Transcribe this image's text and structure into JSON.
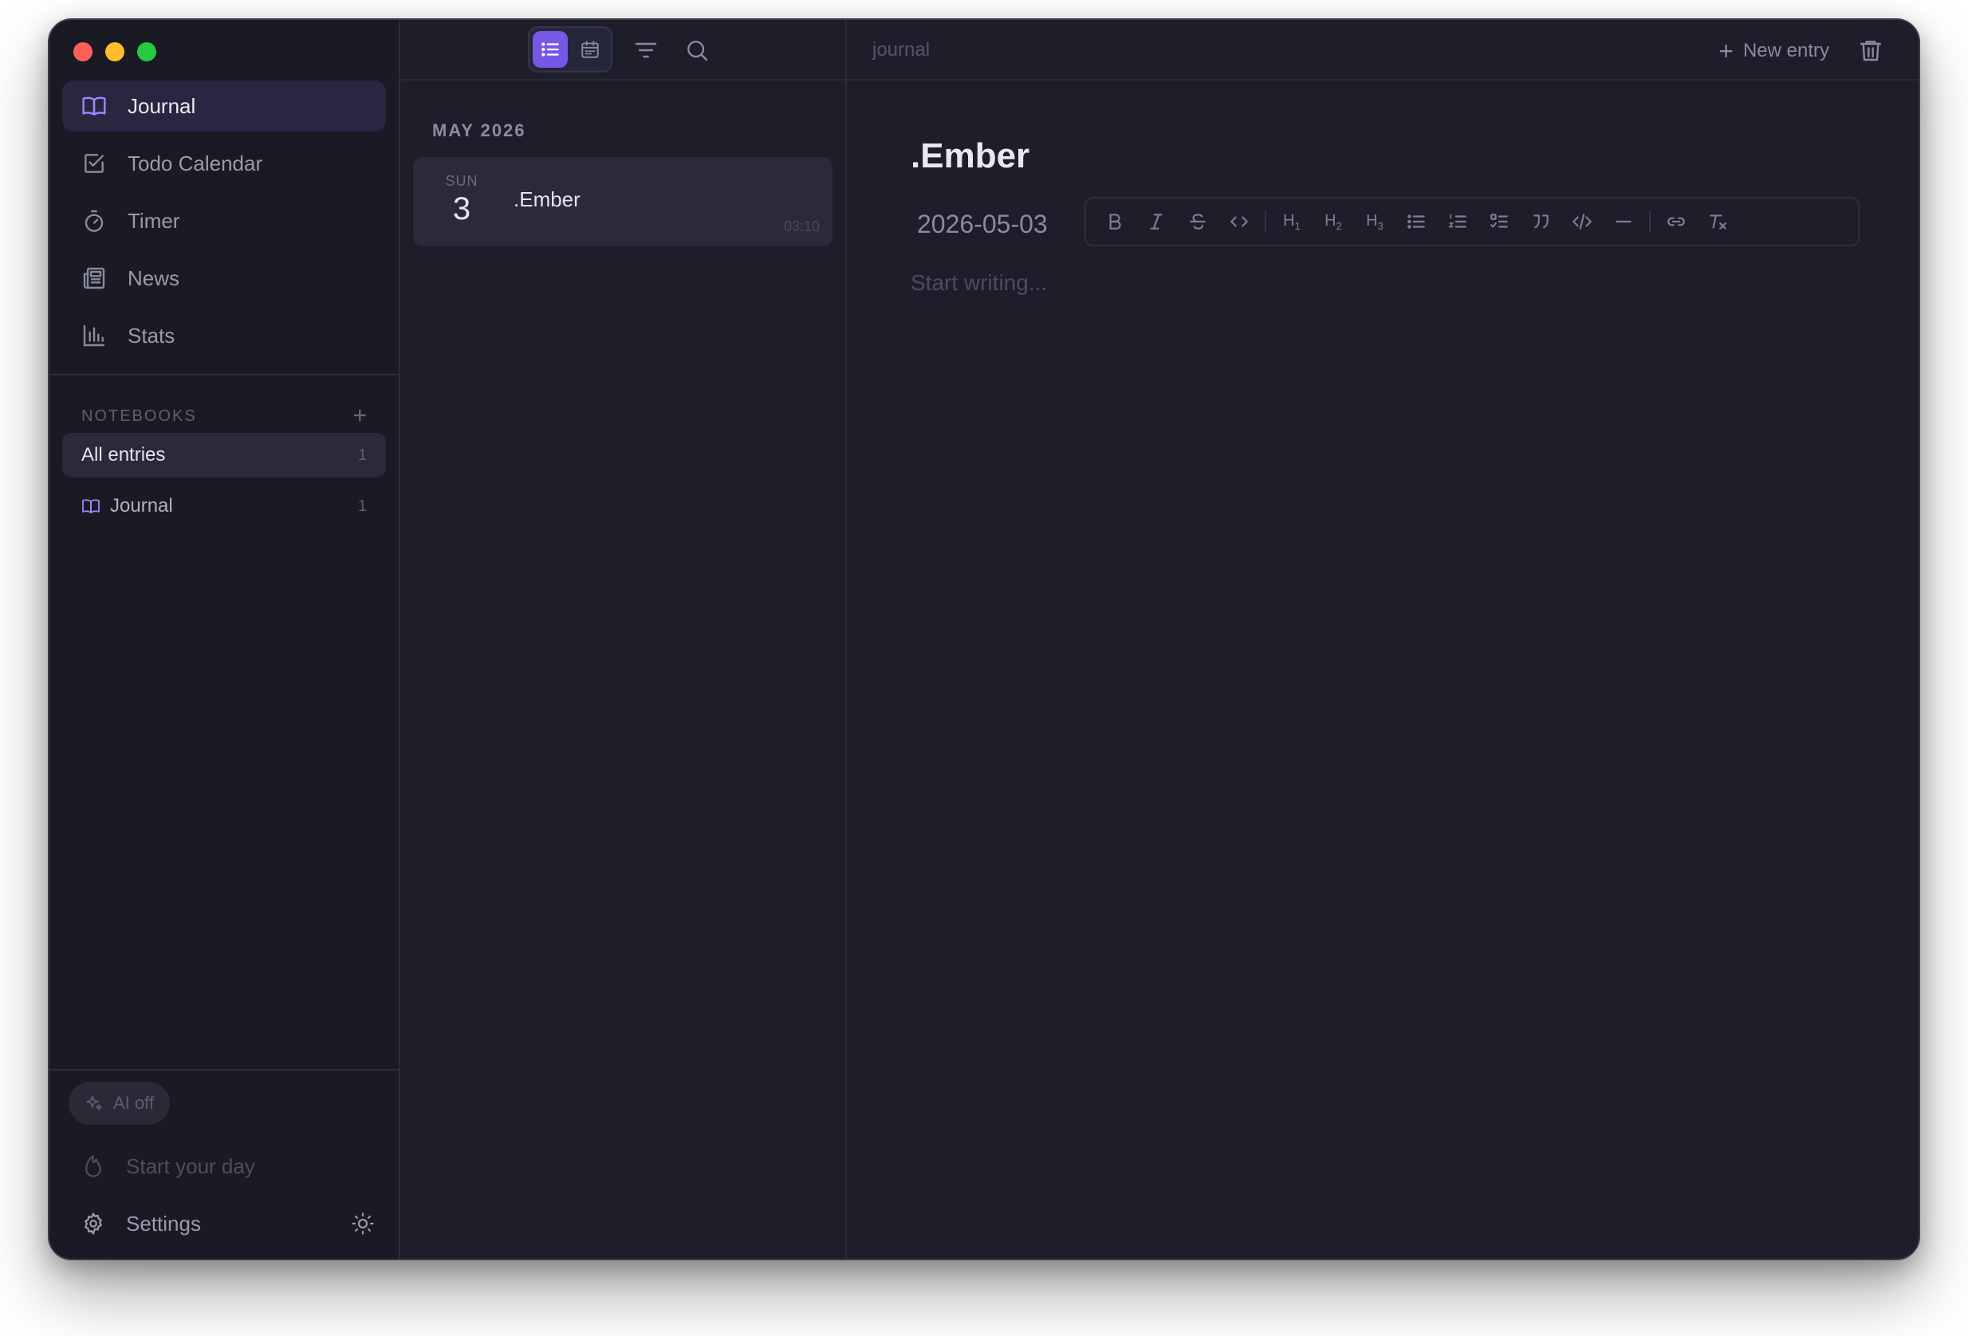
{
  "sidebar": {
    "nav": [
      {
        "label": "Journal",
        "icon": "book-icon",
        "active": true
      },
      {
        "label": "Todo Calendar",
        "icon": "checkbox-icon",
        "active": false
      },
      {
        "label": "Timer",
        "icon": "timer-icon",
        "active": false
      },
      {
        "label": "News",
        "icon": "newspaper-icon",
        "active": false
      },
      {
        "label": "Stats",
        "icon": "bar-chart-icon",
        "active": false
      }
    ],
    "notebooks_header": "NOTEBOOKS",
    "notebooks_add": "+",
    "notebooks": [
      {
        "label": "All entries",
        "count": "1"
      },
      {
        "label": "Journal",
        "count": "1"
      }
    ],
    "ai_toggle": "AI off",
    "start_day": "Start your day",
    "settings": "Settings"
  },
  "list": {
    "month": "MAY 2026",
    "entries": [
      {
        "dow": "SUN",
        "day": "3",
        "title": ".Ember",
        "time": "03:10"
      }
    ]
  },
  "editor": {
    "breadcrumb": "journal",
    "new_entry": "New entry",
    "title": ".Ember",
    "date": "2026-05-03",
    "placeholder": "Start writing..."
  },
  "colors": {
    "accent": "#7657e6",
    "window_bg": "#1e1e2a",
    "sidebar_bg": "#1a1a24"
  }
}
